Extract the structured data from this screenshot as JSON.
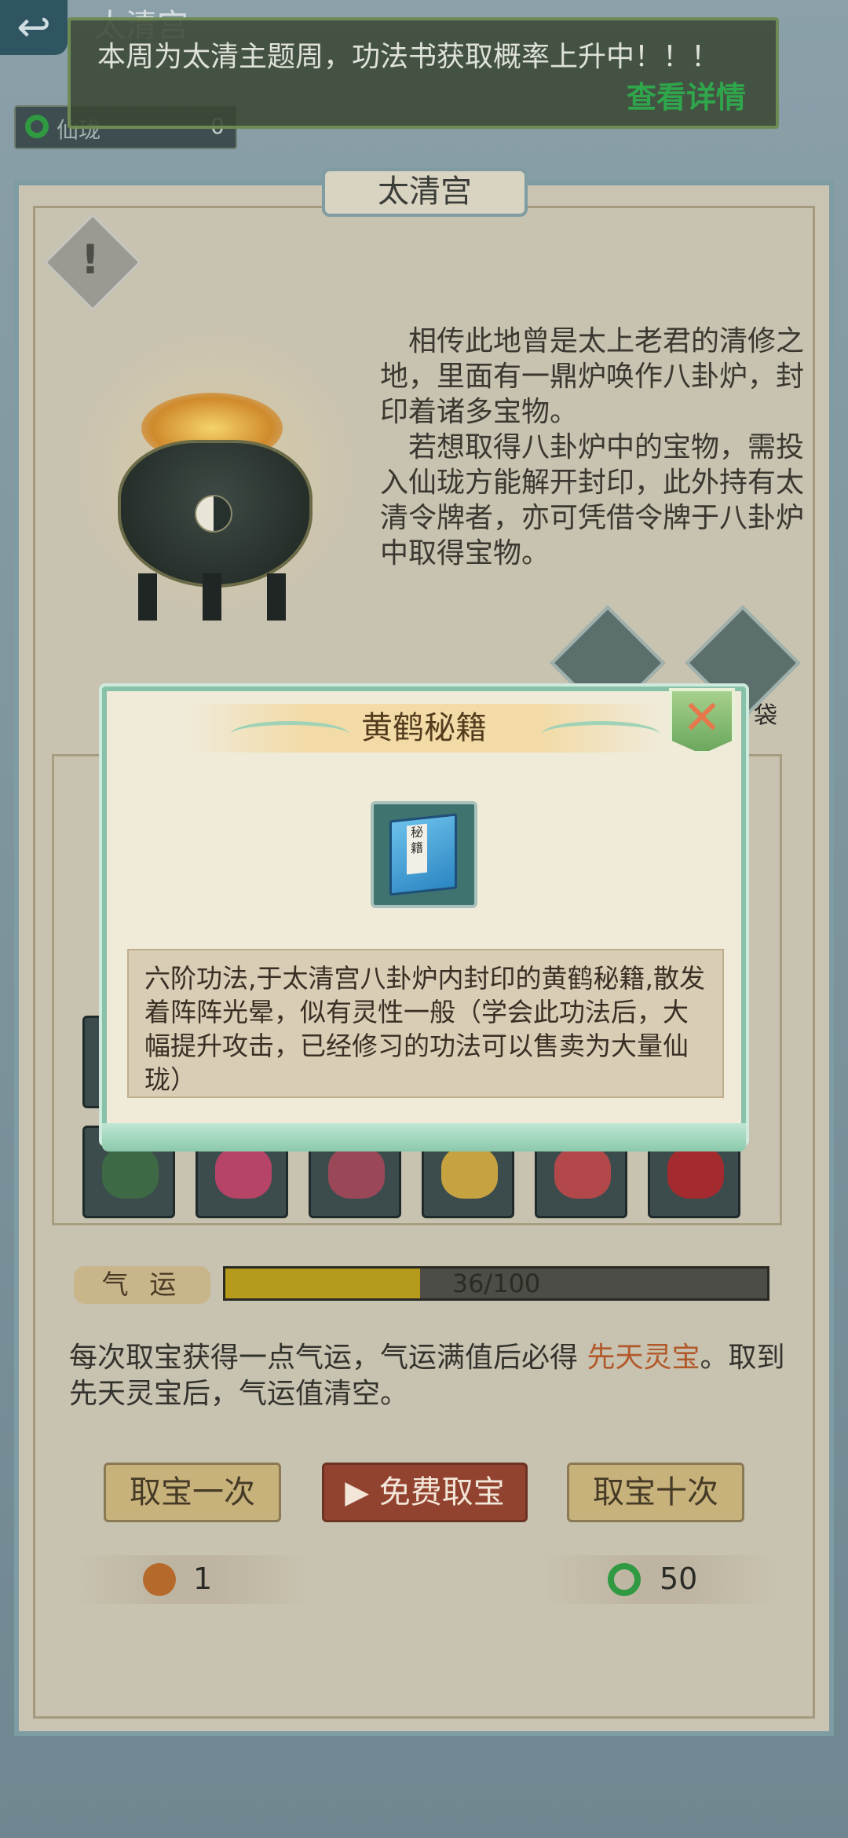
{
  "header": {
    "back_icon": "back-arrow-icon",
    "title": "太清宫",
    "currency": {
      "label": "仙珑",
      "value": "0",
      "icon": "jade-ring-icon"
    },
    "notice": {
      "text": "本周为太清主题周，功法书获取概率上升中！！！",
      "link": "查看详情"
    }
  },
  "panel": {
    "title": "太清宫",
    "lore": [
      "相传此地曾是太上老君的清修之地，里面有一鼎炉唤作八卦炉，封印着诸多宝物。",
      "若想取得八卦炉中的宝物，需投入仙珑方能解开封印，此外持有太清令牌者，亦可凭借令牌于八卦炉中取得宝物。"
    ],
    "side_label": "袋",
    "luck": {
      "label": "气 运",
      "current": 36,
      "max": 100,
      "text": "36/100"
    },
    "luck_desc_1": "每次取宝获得一点气运，气运满值后必得 ",
    "luck_desc_accent": "先天灵宝",
    "luck_desc_2": "。取到先天灵宝后，气运值清空。",
    "buttons": {
      "once": "取宝一次",
      "free": "免费取宝",
      "ten": "取宝十次"
    },
    "costs": {
      "token": "1",
      "jade": "50"
    }
  },
  "modal": {
    "title": "黄鹤秘籍",
    "item_icon": "scripture-book-icon",
    "book_glyph": "秘籍",
    "description": "六阶功法,于太清宫八卦炉内封印的黄鹤秘籍,散发着阵阵光晕，似有灵性一般（学会此功法后，大幅提升攻击，已经修习的功法可以售卖为大量仙珑）"
  },
  "colors": {
    "accent": "#b2592a",
    "luck_fill": "#b59a1c",
    "modal_border": "#87c2a8",
    "notice_link": "#2fa64c"
  }
}
